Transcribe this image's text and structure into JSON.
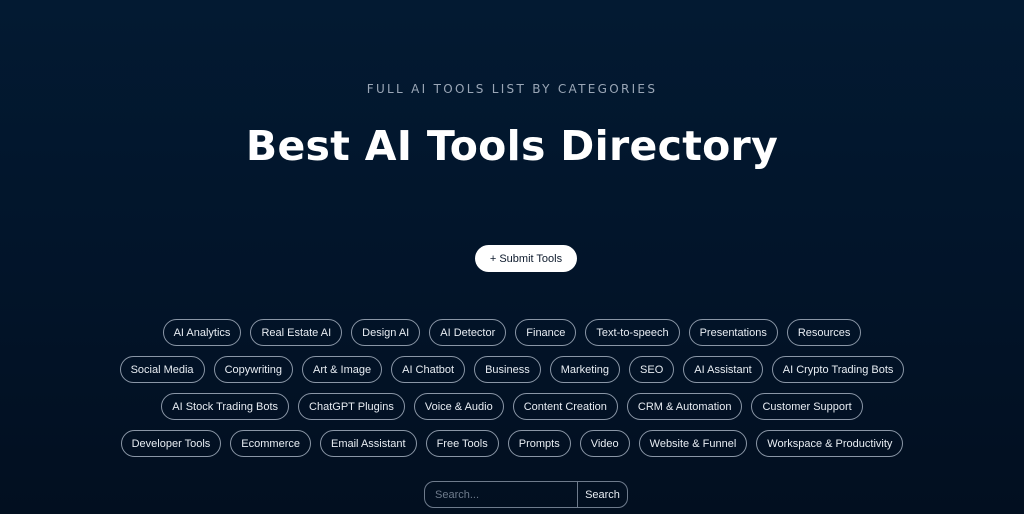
{
  "header": {
    "eyebrow": "FULL AI TOOLS LIST BY CATEGORIES",
    "title": "Best AI Tools Directory"
  },
  "submit_button": {
    "label": "+ Submit Tools"
  },
  "categories": {
    "rows": [
      [
        "AI Analytics",
        "Real Estate AI",
        "Design AI",
        "AI Detector",
        "Finance",
        "Text-to-speech",
        "Presentations",
        "Resources"
      ],
      [
        "Social Media",
        "Copywriting",
        "Art & Image",
        "AI Chatbot",
        "Business",
        "Marketing",
        "SEO",
        "AI Assistant",
        "AI Crypto Trading Bots"
      ],
      [
        "AI Stock Trading Bots",
        "ChatGPT Plugins",
        "Voice & Audio",
        "Content Creation",
        "CRM & Automation",
        "Customer Support"
      ],
      [
        "Developer Tools",
        "Ecommerce",
        "Email Assistant",
        "Free Tools",
        "Prompts",
        "Video",
        "Website & Funnel",
        "Workspace & Productivity"
      ]
    ]
  },
  "search": {
    "placeholder": "Search...",
    "value": "",
    "button_label": "Search"
  },
  "colors": {
    "background_top": "#031a32",
    "background_bottom": "#020f20",
    "pill_border": "#8a96a6",
    "eyebrow_text": "#9aa6b6",
    "submit_bg": "#ffffff"
  }
}
